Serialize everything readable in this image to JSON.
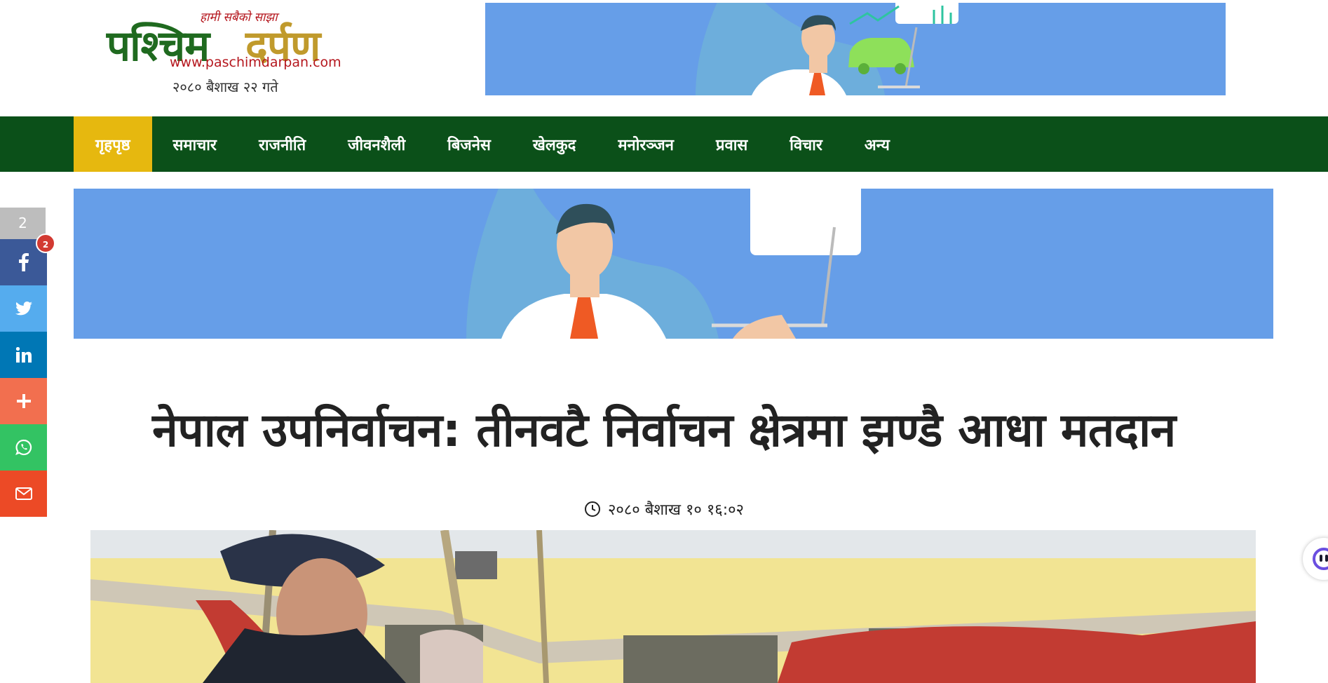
{
  "header": {
    "logo_tagline": "हामी सबैको साझा",
    "logo_name_part1": "पश्चिम",
    "logo_name_part2": "दर्पण",
    "logo_url": "www.paschimdarpan.com",
    "current_date": "२०८० बैशाख २२ गते"
  },
  "nav": {
    "items": [
      "गृहपृष्ठ",
      "समाचार",
      "राजनीति",
      "जीवनशैली",
      "बिजनेस",
      "खेलकुद",
      "मनोरञ्जन",
      "प्रवास",
      "विचार",
      "अन्य"
    ],
    "active_index": 0
  },
  "social": {
    "share_count": "2",
    "facebook_badge": "2",
    "buttons": [
      {
        "name": "facebook",
        "icon": "facebook-icon",
        "color": "#3b5998"
      },
      {
        "name": "twitter",
        "icon": "twitter-icon",
        "color": "#55acee"
      },
      {
        "name": "linkedin",
        "icon": "linkedin-icon",
        "color": "#0077b5"
      },
      {
        "name": "more",
        "icon": "plus-icon",
        "color": "#f26f4f"
      },
      {
        "name": "whatsapp",
        "icon": "whatsapp-icon",
        "color": "#33c363"
      },
      {
        "name": "email",
        "icon": "email-icon",
        "color": "#ec4a26"
      }
    ]
  },
  "article": {
    "headline": "नेपाल उपनिर्वाचन: तीनवटै निर्वाचन क्षेत्रमा झण्डै आधा मतदान",
    "published": "२०८० बैशाख १० १६:०२"
  },
  "colors": {
    "nav_bg": "#0b5019",
    "nav_active": "#e6b80f",
    "ad_bg": "#669ee8",
    "brand_green": "#1f6a1f",
    "brand_gold": "#c09a2c",
    "brand_red": "#b5171e"
  }
}
